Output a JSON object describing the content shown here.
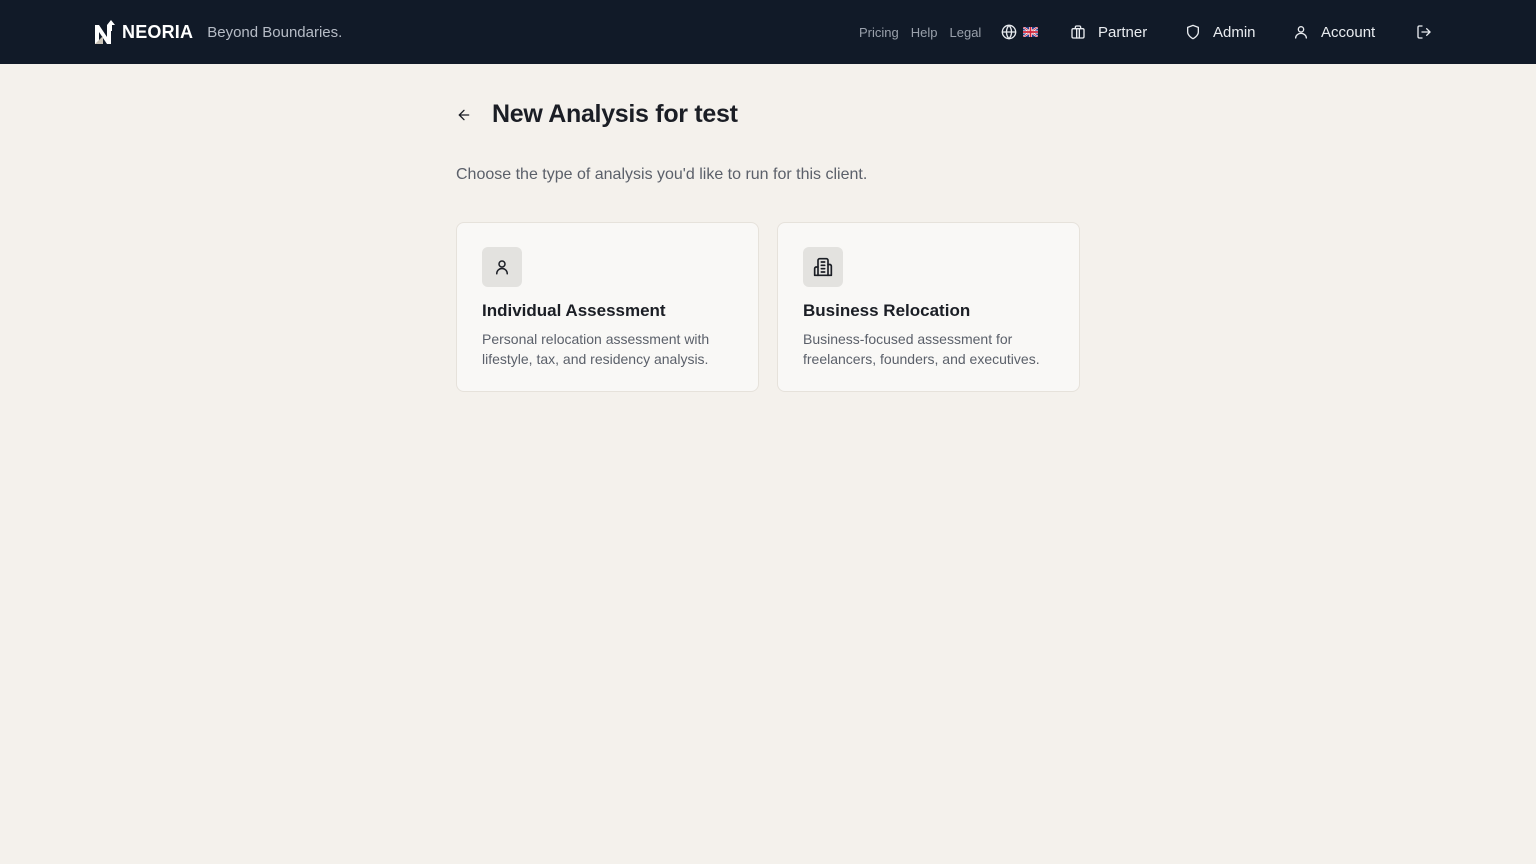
{
  "header": {
    "brand_name": "NEORIA",
    "tagline": "Beyond Boundaries.",
    "links": [
      {
        "label": "Pricing"
      },
      {
        "label": "Help"
      },
      {
        "label": "Legal"
      }
    ],
    "language": {
      "icon": "globe-icon",
      "flag": "uk-flag-icon"
    },
    "buttons": {
      "partner": {
        "label": "Partner",
        "icon": "gift-icon"
      },
      "admin": {
        "label": "Admin",
        "icon": "shield-icon"
      },
      "account": {
        "label": "Account",
        "icon": "user-icon"
      },
      "logout": {
        "icon": "logout-icon"
      }
    }
  },
  "main": {
    "title": "New Analysis for test",
    "subtitle": "Choose the type of analysis you'd like to run for this client.",
    "cards": [
      {
        "title": "Individual Assessment",
        "description": "Personal relocation assessment with lifestyle, tax, and residency analysis.",
        "icon": "user-icon"
      },
      {
        "title": "Business Relocation",
        "description": "Business-focused assessment for freelancers, founders, and executives.",
        "icon": "building-icon"
      }
    ]
  },
  "colors": {
    "navbar_bg": "#111a28",
    "page_bg": "#f4f1ec",
    "card_bg": "#f9f8f6",
    "icon_tile_bg": "#e3e2df"
  }
}
